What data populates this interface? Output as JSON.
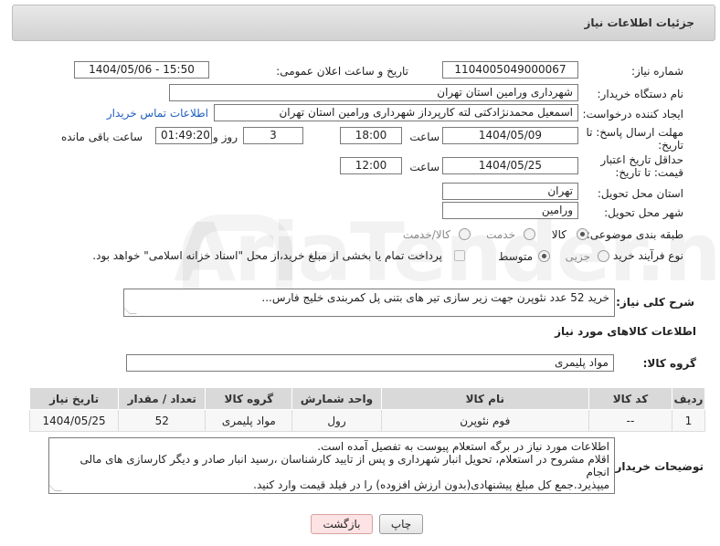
{
  "panel": {
    "title": "جزئیات اطلاعات نیاز"
  },
  "watermark": {
    "text": "AriaTender.net"
  },
  "form": {
    "need_number": {
      "label": "شماره نیاز:",
      "value": "1104005049000067"
    },
    "announce_datetime": {
      "label": "تاریخ و ساعت اعلان عمومی:",
      "value": "1404/05/06 - 15:50"
    },
    "buyer_org": {
      "label": "نام دستگاه خریدار:",
      "value": "شهرداری ورامین استان تهران"
    },
    "requester": {
      "label": "ایجاد کننده درخواست:",
      "value": "اسمعیل محمدنژادکتی لته کارپرداز شهرداری ورامین استان تهران",
      "contact_link": "اطلاعات تماس خریدار"
    },
    "reply_deadline": {
      "label": "مهلت ارسال پاسخ: تا تاریخ:",
      "date": "1404/05/09",
      "time_label": "ساعت",
      "time": "18:00",
      "days": "3",
      "days_label": "روز و",
      "remaining": "01:49:20",
      "remaining_label": "ساعت باقی مانده"
    },
    "price_validity": {
      "label": "حداقل تاریخ اعتبار قیمت: تا تاریخ:",
      "date": "1404/05/25",
      "time_label": "ساعت",
      "time": "12:00"
    },
    "province": {
      "label": "استان محل تحویل:",
      "value": "تهران"
    },
    "city": {
      "label": "شهر محل تحویل:",
      "value": "ورامین"
    },
    "category": {
      "label": "طبقه بندی موضوعی:",
      "options": [
        "کالا",
        "خدمت",
        "کالا/خدمت"
      ],
      "selected": "کالا"
    },
    "purchase_process": {
      "label": "نوع فرآیند خرید :",
      "options": [
        "جزیی",
        "متوسط"
      ],
      "selected": "متوسط",
      "payment_note": "پرداخت تمام یا بخشی از مبلغ خرید،از محل \"اسناد خزانه اسلامی\" خواهد بود."
    },
    "overall_desc": {
      "label": "شرح کلی نیاز:",
      "value": "خرید 52 عدد نئوپرن جهت زیر سازی تیر های بتنی پل کمربندی خلیج فارس..."
    }
  },
  "goods": {
    "section_title": "اطلاعات کالاهای مورد نیاز",
    "group_label": "گروه کالا:",
    "group_value": "مواد پلیمری",
    "columns": [
      "ردیف",
      "کد کالا",
      "نام کالا",
      "واحد شمارش",
      "گروه کالا",
      "تعداد / مقدار",
      "تاریخ نیاز"
    ],
    "rows": [
      [
        "1",
        "--",
        "فوم نئوپرن",
        "رول",
        "مواد پلیمری",
        "52",
        "1404/05/25"
      ]
    ]
  },
  "buyer_notes": {
    "label": "توضیحات خریدار:",
    "line1": "اطلاعات مورد نیاز در برگه استعلام پیوست به تفصیل آمده است.",
    "line2": "اقلام مشروح در استعلام، تحویل انبار شهرداری و پس از تایید کارشناسان ،رسید انبار صادر و دیگر کارسازی های مالی انجام",
    "line3": "میپذیرد.جمع کل مبلغ پیشنهادی(بدون ارزش افزوده) را در فیلد قیمت وارد کنید."
  },
  "buttons": {
    "print": "چاپ",
    "back": "بازگشت"
  }
}
